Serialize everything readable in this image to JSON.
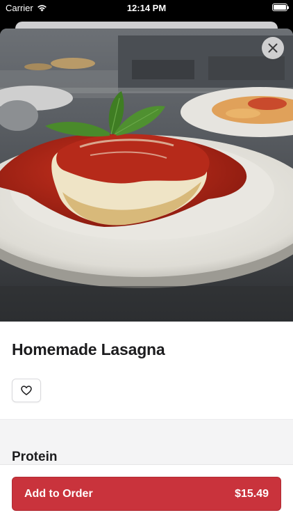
{
  "status_bar": {
    "carrier": "Carrier",
    "time": "12:14 PM",
    "battery_level": 1.0
  },
  "item": {
    "title": "Homemade Lasagna",
    "photo_description_icon": "food-photo"
  },
  "actions": {
    "close_icon": "close-icon",
    "favorite_icon": "heart-outline-icon"
  },
  "options": {
    "section_title": "Protein"
  },
  "order_button": {
    "label": "Add to Order",
    "price": "$15.49"
  },
  "colors": {
    "accent": "#c9333c",
    "title_text": "#1c1c1e",
    "section_background": "#f4f4f5"
  }
}
